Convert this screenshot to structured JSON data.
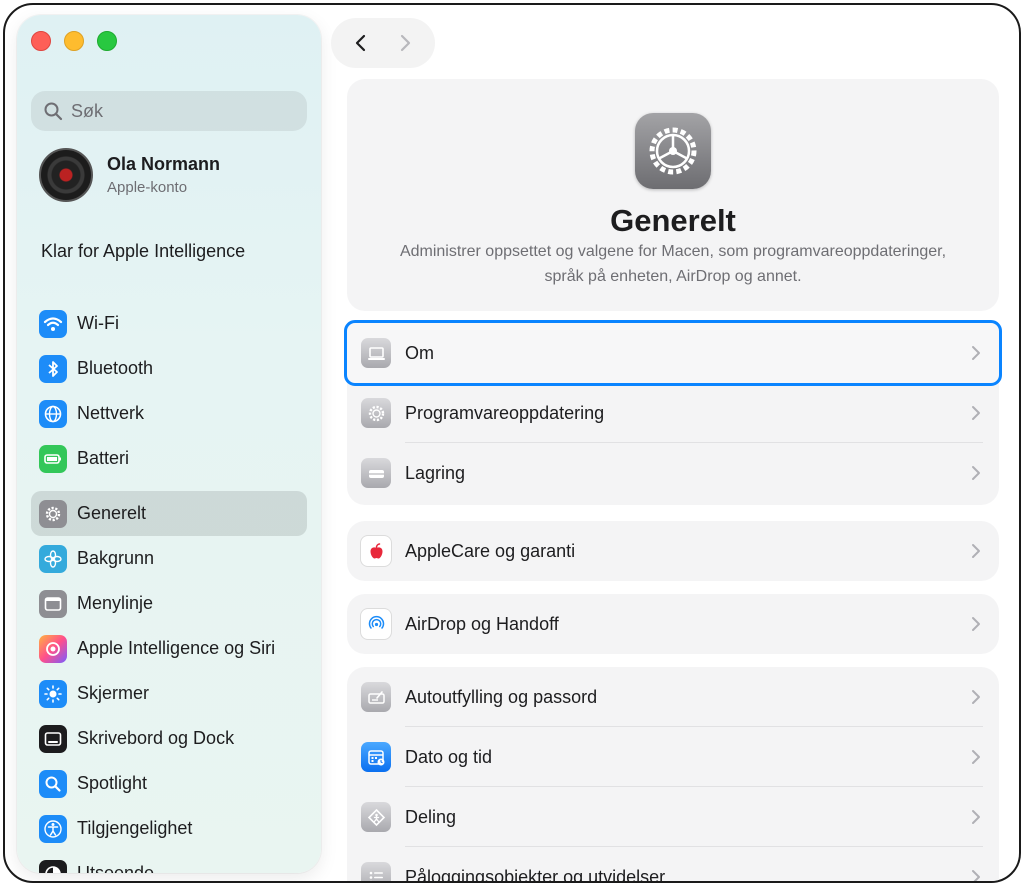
{
  "sidebar": {
    "search_placeholder": "Søk",
    "account": {
      "name": "Ola Normann",
      "subtitle": "Apple-konto"
    },
    "ai_banner": "Klar for Apple Intelligence",
    "group1": [
      {
        "label": "Wi-Fi",
        "icon": "wifi-icon",
        "color": "#1d8cf8"
      },
      {
        "label": "Bluetooth",
        "icon": "bluetooth-icon",
        "color": "#1d8cf8"
      },
      {
        "label": "Nettverk",
        "icon": "globe-icon",
        "color": "#1d8cf8"
      },
      {
        "label": "Batteri",
        "icon": "battery-icon",
        "color": "#33c759"
      }
    ],
    "group2": [
      {
        "label": "Generelt",
        "icon": "gear-icon",
        "color": "#8e8e93",
        "selected": true
      },
      {
        "label": "Bakgrunn",
        "icon": "flower-icon",
        "color": "#34aadc"
      },
      {
        "label": "Menylinje",
        "icon": "menubar-icon",
        "color": "#8e8e93"
      },
      {
        "label": "Apple Intelligence og Siri",
        "icon": "siri-icon",
        "color": "#ff6b9a"
      },
      {
        "label": "Skjermer",
        "icon": "brightness-icon",
        "color": "#1d8cf8"
      },
      {
        "label": "Skrivebord og Dock",
        "icon": "dock-icon",
        "color": "#1c1c1e"
      },
      {
        "label": "Spotlight",
        "icon": "magnifier-icon",
        "color": "#1d8cf8"
      },
      {
        "label": "Tilgjengelighet",
        "icon": "accessibility-icon",
        "color": "#1d8cf8"
      },
      {
        "label": "Utseende",
        "icon": "appearance-icon",
        "color": "#1c1c1e"
      }
    ]
  },
  "header": {
    "title": "Generelt",
    "description_line1": "Administrer oppsettet og valgene for Macen, som programvareoppdateringer,",
    "description_line2": "språk på enheten, AirDrop og annet."
  },
  "groups": {
    "g1": [
      {
        "label": "Om",
        "icon": "laptop-icon",
        "focused": true
      },
      {
        "label": "Programvareoppdatering",
        "icon": "gear-badge-icon"
      },
      {
        "label": "Lagring",
        "icon": "drive-icon"
      }
    ],
    "g2": [
      {
        "label": "AppleCare og garanti",
        "icon": "apple-logo-icon"
      }
    ],
    "g3": [
      {
        "label": "AirDrop og Handoff",
        "icon": "airdrop-icon"
      }
    ],
    "g4": [
      {
        "label": "Autoutfylling og passord",
        "icon": "keyboard-pen-icon"
      },
      {
        "label": "Dato og tid",
        "icon": "calendar-clock-icon"
      },
      {
        "label": "Deling",
        "icon": "sharing-icon"
      },
      {
        "label": "Påloggingsobjekter og utvidelser",
        "icon": "list-icon"
      }
    ]
  },
  "colors": {
    "accent": "#0a84ff",
    "close": "#fe5f57",
    "minimize": "#febc2e",
    "zoom": "#28c840"
  }
}
